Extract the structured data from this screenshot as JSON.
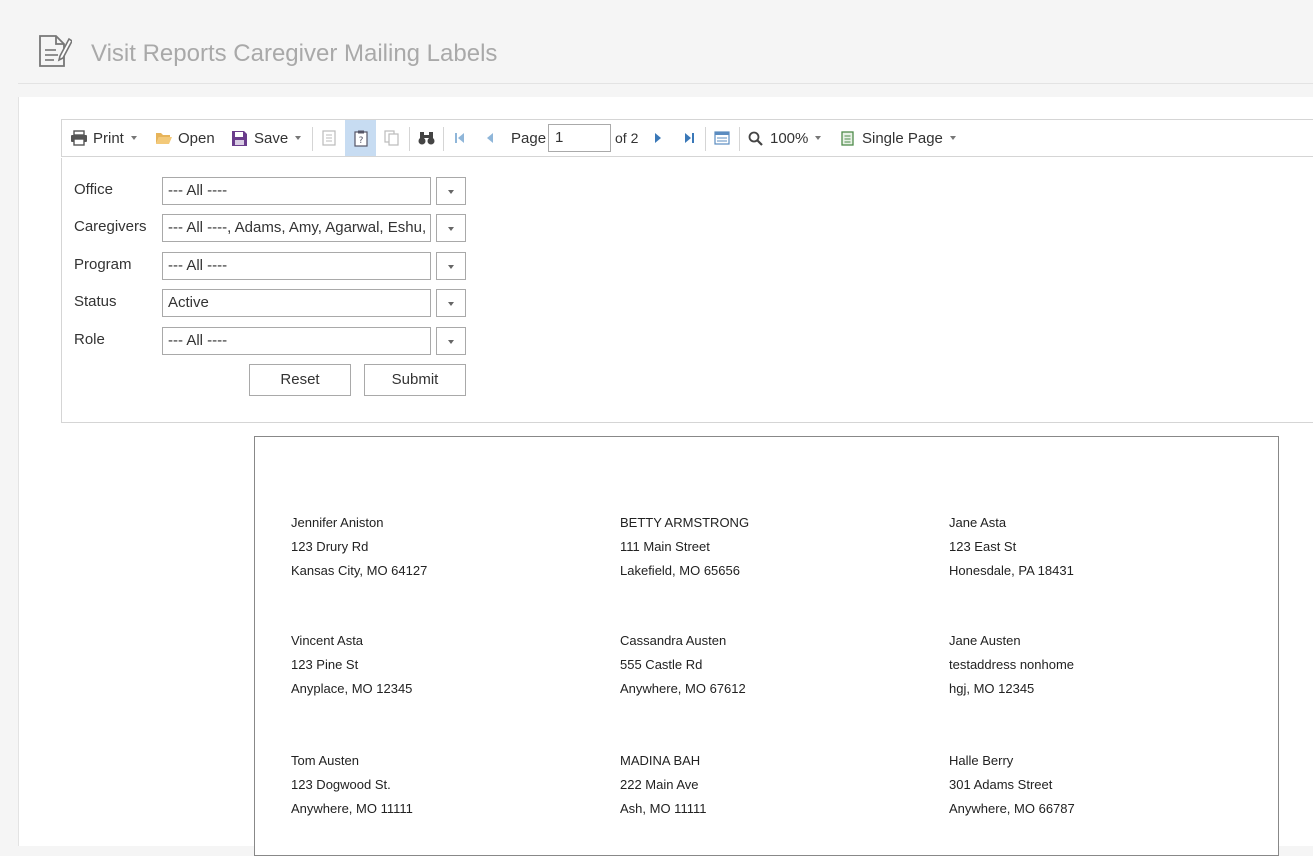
{
  "header": {
    "title": "Visit Reports Caregiver Mailing Labels",
    "icon": "report-document-icon"
  },
  "toolbar": {
    "print_label": "Print",
    "open_label": "Open",
    "save_label": "Save",
    "page_label": "Page",
    "page_value": "1",
    "page_of": "of 2",
    "zoom_label": "100%",
    "view_mode_label": "Single Page"
  },
  "params": {
    "fields": [
      {
        "label": "Office",
        "value": "--- All ----"
      },
      {
        "label": "Caregivers",
        "value": "--- All ----, Adams, Amy, Agarwal, Eshu, ..."
      },
      {
        "label": "Program",
        "value": "--- All ----"
      },
      {
        "label": "Status",
        "value": "Active"
      },
      {
        "label": "Role",
        "value": "--- All ----"
      }
    ],
    "reset_label": "Reset",
    "submit_label": "Submit"
  },
  "labels": [
    {
      "name": "Jennifer Aniston",
      "street": "123 Drury Rd",
      "city": "Kansas City, MO 64127"
    },
    {
      "name": "BETTY ARMSTRONG",
      "street": "111 Main Street",
      "city": "Lakefield, MO 65656"
    },
    {
      "name": "Jane Asta",
      "street": "123 East St",
      "city": "Honesdale, PA 18431"
    },
    {
      "name": "Vincent Asta",
      "street": "123 Pine St",
      "city": "Anyplace, MO 12345"
    },
    {
      "name": "Cassandra Austen",
      "street": "555 Castle Rd",
      "city": "Anywhere, MO 67612"
    },
    {
      "name": "Jane Austen",
      "street": "testaddress nonhome",
      "city": "hgj, MO 12345"
    },
    {
      "name": "Tom Austen",
      "street": "123 Dogwood St.",
      "city": "Anywhere, MO 11111"
    },
    {
      "name": "MADINA BAH",
      "street": "222 Main Ave",
      "city": "Ash, MO 11111"
    },
    {
      "name": "Halle Berry",
      "street": "301 Adams Street",
      "city": "Anywhere, MO 66787"
    }
  ]
}
